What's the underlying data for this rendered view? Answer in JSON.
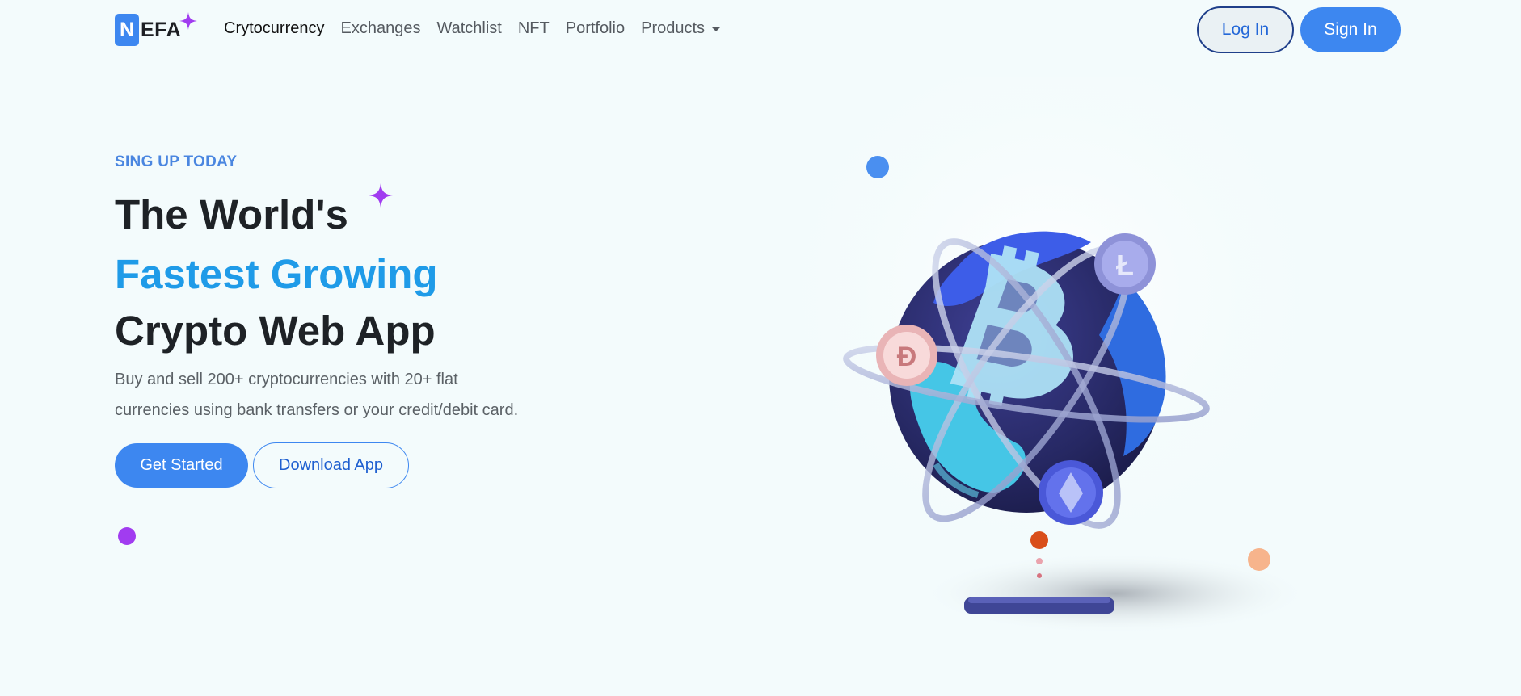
{
  "brand": {
    "logo_initial": "N",
    "logo_rest": "EFA",
    "colors": {
      "primary": "#3d87f0",
      "accent_text": "#1f9be8",
      "spark": "#a13cf0"
    }
  },
  "nav": {
    "items": [
      {
        "label": "Crytocurrency",
        "active": true
      },
      {
        "label": "Exchanges"
      },
      {
        "label": "Watchlist"
      },
      {
        "label": "NFT"
      },
      {
        "label": "Portfolio"
      },
      {
        "label": "Products",
        "dropdown": true
      }
    ],
    "login_label": "Log In",
    "signin_label": "Sign In"
  },
  "hero": {
    "eyebrow": "SING UP TODAY",
    "headline_line1": "The World's",
    "headline_line2": "Fastest Growing",
    "headline_line3": "Crypto Web App",
    "lead_line1": "Buy and sell 200+ cryptocurrencies with 20+ flat",
    "lead_line2": "currencies using bank transfers or your credit/debit card.",
    "cta_primary": "Get Started",
    "cta_secondary": "Download App"
  },
  "illustration": {
    "icons": [
      "bitcoin-globe-icon",
      "litecoin-coin-icon",
      "dogecoin-coin-icon",
      "ethereum-coin-icon",
      "phone-icon"
    ]
  }
}
